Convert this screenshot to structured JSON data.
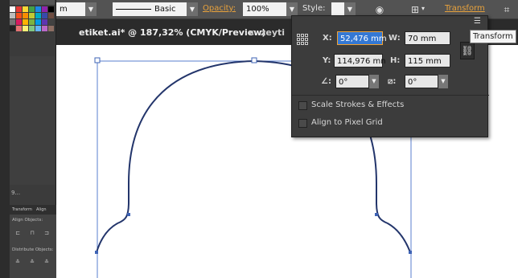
{
  "control_bar": {
    "unit_value": "m",
    "stroke_profile": "Basic",
    "opacity_label": "Opacity:",
    "opacity_value": "100%",
    "style_label": "Style:",
    "transform_link": "Transform",
    "icons": [
      "globe-icon",
      "align-grid-icon",
      "constrain-icon"
    ]
  },
  "document": {
    "active_tab": "etiket.ai* @ 187,32% (CMYK/Preview)",
    "close_glyph": "×",
    "second_tab": "zeyti"
  },
  "transform_panel": {
    "x_label": "X:",
    "x_value": "52,476 mm",
    "y_label": "Y:",
    "y_value": "114,976 mn",
    "w_label": "W:",
    "w_value": "70 mm",
    "h_label": "H:",
    "h_value": "115 mm",
    "rotate_value": "0°",
    "shear_value": "0°",
    "scale_strokes_label": "Scale Strokes & Effects",
    "align_pixel_label": "Align to Pixel Grid",
    "scale_strokes_checked": false,
    "align_pixel_checked": false
  },
  "tooltip": "Transform",
  "left_dock": {
    "misc_text": "9...",
    "align_tabs": [
      "Transform",
      "Align"
    ],
    "align_objects_label": "Align Objects:",
    "distribute_objects_label": "Distribute Objects:"
  },
  "colors": {
    "accent_orange": "#e8a23c",
    "selection_blue": "#3478d4",
    "path_blue": "#3e63b5",
    "panel_bg": "#3c3c3c"
  }
}
